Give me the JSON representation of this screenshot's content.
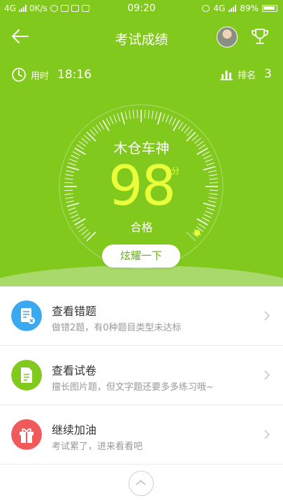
{
  "status_bar": {
    "network_left": "4G",
    "speed": "0K/s",
    "time": "09:20",
    "network_right": "4G",
    "battery": "89%"
  },
  "header": {
    "title": "考试成绩"
  },
  "stats": {
    "time_label": "用时",
    "time_value": "18:16",
    "rank_label": "排名",
    "rank_value": "3"
  },
  "result": {
    "grade_title": "木仓车神",
    "score": "98",
    "score_unit": "分",
    "status": "合格",
    "score_fraction": 0.98
  },
  "share_button": "炫耀一下",
  "menu": [
    {
      "title": "查看错题",
      "subtitle": "做错2题，有0种题目类型未达标",
      "icon": "mistakes-doc-icon",
      "color": "#3aa9f0"
    },
    {
      "title": "查看试卷",
      "subtitle": "擅长图片题，但文字题还要多多练习哦~",
      "icon": "paper-doc-icon",
      "color": "#82c91e"
    },
    {
      "title": "继续加油",
      "subtitle": "考试累了，进来看看吧",
      "icon": "gift-icon",
      "color": "#f05a5a"
    }
  ],
  "colors": {
    "accent": "#82c91e",
    "score": "#e8ff3a"
  }
}
